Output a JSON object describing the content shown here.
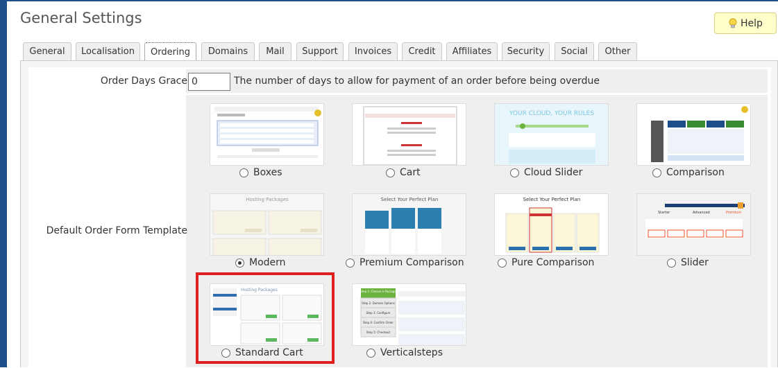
{
  "page": {
    "title": "General Settings",
    "help_label": "Help"
  },
  "tabs": [
    {
      "label": "General",
      "active": false
    },
    {
      "label": "Localisation",
      "active": false
    },
    {
      "label": "Ordering",
      "active": true
    },
    {
      "label": "Domains",
      "active": false
    },
    {
      "label": "Mail",
      "active": false
    },
    {
      "label": "Support",
      "active": false
    },
    {
      "label": "Invoices",
      "active": false
    },
    {
      "label": "Credit",
      "active": false
    },
    {
      "label": "Affiliates",
      "active": false
    },
    {
      "label": "Security",
      "active": false
    },
    {
      "label": "Social",
      "active": false
    },
    {
      "label": "Other",
      "active": false
    }
  ],
  "fields": {
    "order_days_grace": {
      "label": "Order Days Grace",
      "value": "0",
      "description": "The number of days to allow for payment of an order before being overdue"
    },
    "default_order_form": {
      "label": "Default Order Form Template",
      "selected": "Modern",
      "templates": [
        {
          "label": "Boxes",
          "checked": false
        },
        {
          "label": "Cart",
          "checked": false
        },
        {
          "label": "Cloud Slider",
          "checked": false
        },
        {
          "label": "Comparison",
          "checked": false
        },
        {
          "label": "Modern",
          "checked": true
        },
        {
          "label": "Premium Comparison",
          "checked": false
        },
        {
          "label": "Pure Comparison",
          "checked": false
        },
        {
          "label": "Slider",
          "checked": false
        },
        {
          "label": "Standard Cart",
          "checked": false
        },
        {
          "label": "Verticalsteps",
          "checked": false
        }
      ]
    }
  },
  "thumb_text": {
    "cloud_slider": "YOUR CLOUD, YOUR RULES",
    "pure_comparison": "Select Your Perfect Plan",
    "premium_comparison": "Select Your Perfect Plan",
    "modern": "Hosting Packages",
    "standard_cart": "Hosting Packages",
    "verticalsteps": [
      "Step 1: Choose a Package",
      "Step 2: Domain Options",
      "Step 3: Configure",
      "Step 4: Confirm Order",
      "Step 5: Checkout"
    ],
    "slider": [
      "Starter",
      "Advanced",
      "Premium"
    ]
  },
  "colors": {
    "accent": "#1c4f8c",
    "highlight": "#e0201f",
    "help_bg": "#ffffcc"
  }
}
